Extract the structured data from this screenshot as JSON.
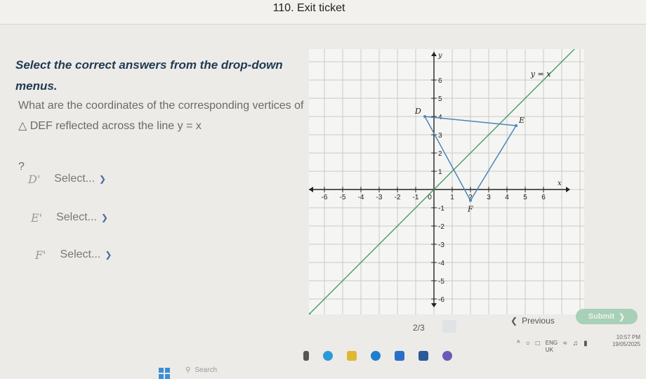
{
  "header": {
    "title": "110. Exit ticket"
  },
  "question": {
    "instruction": "Select the correct answers from the drop-down menus.",
    "text": "What are the coordinates of the corresponding vertices of △ DEF reflected across the line y = x",
    "trailer": "?"
  },
  "answers": [
    {
      "label": "D'",
      "placeholder": "Select..."
    },
    {
      "label": "E'",
      "placeholder": "Select..."
    },
    {
      "label": "F'",
      "placeholder": "Select..."
    }
  ],
  "graph": {
    "x_ticks": [
      "-6",
      "-5",
      "-4",
      "-3",
      "-2",
      "-1",
      "0",
      "1",
      "2",
      "3",
      "4",
      "5",
      "6"
    ],
    "y_ticks_pos": [
      "1",
      "2",
      "3",
      "4",
      "5",
      "6"
    ],
    "y_ticks_neg": [
      "-1",
      "-2",
      "-3",
      "-4",
      "-5",
      "-6"
    ],
    "x_axis_label": "x",
    "y_axis_label": "y",
    "line_label": "y = x",
    "points": [
      {
        "name": "D",
        "x": -0.5,
        "y": 4
      },
      {
        "name": "E",
        "x": 4.5,
        "y": 3.5
      },
      {
        "name": "F",
        "x": 2,
        "y": -0.6
      }
    ]
  },
  "nav": {
    "previous": "Previous",
    "submit": "Submit",
    "page": "2/3"
  },
  "taskbar": {
    "search": "Search",
    "lang1": "ENG",
    "lang2": "UK",
    "time": "10:57 PM",
    "date": "19/05/2025"
  }
}
